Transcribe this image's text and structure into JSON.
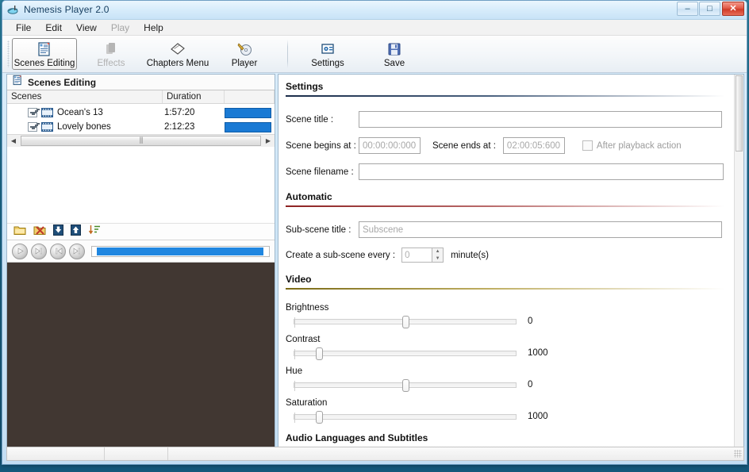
{
  "window": {
    "title": "Nemesis Player 2.0",
    "icon": "app-icon",
    "controls": {
      "minimize": "–",
      "maximize": "□",
      "close": "✕"
    }
  },
  "menubar": {
    "items": [
      {
        "label": "File",
        "disabled": false
      },
      {
        "label": "Edit",
        "disabled": false
      },
      {
        "label": "View",
        "disabled": false
      },
      {
        "label": "Play",
        "disabled": true
      },
      {
        "label": "Help",
        "disabled": false
      }
    ]
  },
  "toolbar": {
    "buttons": [
      {
        "label": "Scenes Editing",
        "icon": "scenes-editing-icon",
        "selected": true,
        "disabled": false
      },
      {
        "label": "Effects",
        "icon": "effects-icon",
        "selected": false,
        "disabled": true
      },
      {
        "label": "Chapters Menu",
        "icon": "chapters-menu-icon",
        "selected": false,
        "disabled": false
      },
      {
        "label": "Player",
        "icon": "player-icon",
        "selected": false,
        "disabled": false
      }
    ],
    "buttons_right": [
      {
        "label": "Settings",
        "icon": "settings-icon",
        "selected": false,
        "disabled": false
      },
      {
        "label": "Save",
        "icon": "save-icon",
        "selected": false,
        "disabled": false
      }
    ]
  },
  "left_panel": {
    "header": "Scenes Editing",
    "header_icon": "scenes-editing-icon",
    "columns": [
      "Scenes",
      "Duration",
      ""
    ],
    "rows": [
      {
        "checked": true,
        "icon": "film-icon",
        "title": "Ocean's 13",
        "duration": "1:57:20",
        "bar_color": "#1a7ad4"
      },
      {
        "checked": true,
        "icon": "film-icon",
        "title": "Lovely bones",
        "duration": "2:12:23",
        "bar_color": "#1a7ad4"
      }
    ],
    "scrollbar": {
      "left_arrow": "◀",
      "right_arrow": "▶",
      "grip": "|||"
    },
    "mini_toolbar": [
      {
        "name": "add-scene-button",
        "icon": "add-folder-icon"
      },
      {
        "name": "delete-scene-button",
        "icon": "delete-icon"
      },
      {
        "name": "move-down-button",
        "icon": "arrow-down-icon"
      },
      {
        "name": "move-up-button",
        "icon": "arrow-up-icon"
      },
      {
        "name": "sort-button",
        "icon": "sort-icon"
      }
    ],
    "player_controls": [
      {
        "name": "play-button",
        "icon": "play-icon"
      },
      {
        "name": "next-button",
        "icon": "next-icon"
      },
      {
        "name": "previous-button",
        "icon": "previous-icon"
      },
      {
        "name": "stop-button",
        "icon": "stop-icon"
      }
    ],
    "seek": {
      "value_percent": 97
    },
    "preview_color": "#413732"
  },
  "settings": {
    "section_settings": {
      "title": "Settings",
      "rule_color": "#1b2d4a",
      "scene_title_label": "Scene title :",
      "scene_title_value": "",
      "scene_begins_label": "Scene begins at :",
      "scene_begins_value": "00:00:00:000",
      "scene_ends_label": "Scene ends at :",
      "scene_ends_value": "02:00:05:600",
      "after_playback_label": "After playback action",
      "after_playback_checked": false,
      "scene_filename_label": "Scene filename :",
      "scene_filename_value": ""
    },
    "section_automatic": {
      "title": "Automatic",
      "rule_color": "#8d2222",
      "subscene_title_label": "Sub-scene title :",
      "subscene_title_placeholder": "Subscene",
      "create_subscene_label": "Create a sub-scene every :",
      "create_subscene_value": "0",
      "minutes_label": "minute(s)",
      "spin_up": "▲",
      "spin_down": "▼"
    },
    "section_video": {
      "title": "Video",
      "rule_color": "#7a6a16",
      "sliders": [
        {
          "label": "Brightness",
          "value": "0",
          "percent": 50
        },
        {
          "label": "Contrast",
          "value": "1000",
          "percent": 11
        },
        {
          "label": "Hue",
          "value": "0",
          "percent": 50
        },
        {
          "label": "Saturation",
          "value": "1000",
          "percent": 11
        }
      ]
    },
    "section_audio": {
      "title": "Audio Languages and Subtitles"
    }
  },
  "statusbar": {
    "pane1": "",
    "pane2": "",
    "pane3": ""
  }
}
